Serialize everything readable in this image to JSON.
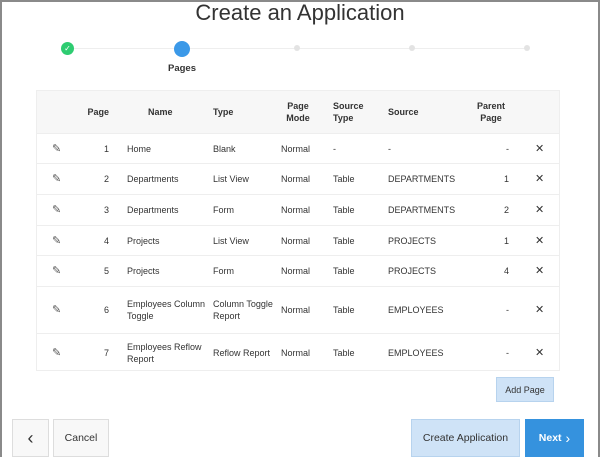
{
  "title": "Create an Application",
  "steps": [
    {
      "state": "done"
    },
    {
      "state": "current",
      "label": "Pages"
    },
    {
      "state": "todo"
    },
    {
      "state": "todo"
    },
    {
      "state": "todo"
    }
  ],
  "colors": {
    "done": "#2ecc71",
    "current": "#3b99e8",
    "primary": "#3592de"
  },
  "table": {
    "headers": {
      "page": "Page",
      "name": "Name",
      "type": "Type",
      "mode": "Page Mode",
      "stype": "Source Type",
      "source": "Source",
      "parent": "Parent Page"
    },
    "rows": [
      {
        "page": "1",
        "name": "Home",
        "type": "Blank",
        "mode": "Normal",
        "stype": "-",
        "source": "-",
        "parent": "-"
      },
      {
        "page": "2",
        "name": "Departments",
        "type": "List View",
        "mode": "Normal",
        "stype": "Table",
        "source": "DEPARTMENTS",
        "parent": "1"
      },
      {
        "page": "3",
        "name": "Departments",
        "type": "Form",
        "mode": "Normal",
        "stype": "Table",
        "source": "DEPARTMENTS",
        "parent": "2"
      },
      {
        "page": "4",
        "name": "Projects",
        "type": "List View",
        "mode": "Normal",
        "stype": "Table",
        "source": "PROJECTS",
        "parent": "1"
      },
      {
        "page": "5",
        "name": "Projects",
        "type": "Form",
        "mode": "Normal",
        "stype": "Table",
        "source": "PROJECTS",
        "parent": "4"
      },
      {
        "page": "6",
        "name": "Employees Column Toggle",
        "type": "Column Toggle Report",
        "mode": "Normal",
        "stype": "Table",
        "source": "EMPLOYEES",
        "parent": "-"
      },
      {
        "page": "7",
        "name": "Employees Reflow Report",
        "type": "Reflow Report",
        "mode": "Normal",
        "stype": "Table",
        "source": "EMPLOYEES",
        "parent": "-"
      }
    ]
  },
  "buttons": {
    "add_page": "Add Page",
    "back": "‹",
    "cancel": "Cancel",
    "create": "Create Application",
    "next": "Next"
  }
}
